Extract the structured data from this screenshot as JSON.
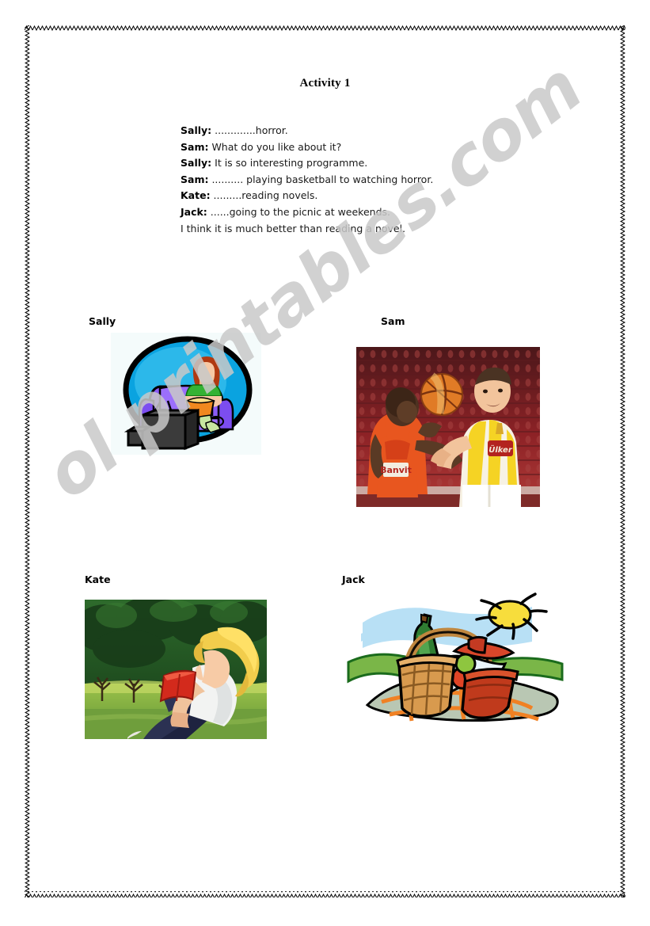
{
  "document": {
    "title": "Activity 1",
    "watermark": "ol printables.com"
  },
  "dialogue": {
    "lines": [
      {
        "speaker": "Sally:",
        "text": " .............horror."
      },
      {
        "speaker": "Sam:",
        "text": " What do you like about it?"
      },
      {
        "speaker": "Sally:",
        "text": " It is so interesting programme."
      },
      {
        "speaker": "Sam:",
        "text": " .......... playing basketball to watching horror."
      },
      {
        "speaker": "Kate:",
        "text": " .........reading novels."
      },
      {
        "speaker": "Jack:",
        "text": " ......going to the picnic at weekends."
      },
      {
        "speaker": "",
        "text": "I think it is much better than reading a novel."
      }
    ]
  },
  "pictures": [
    {
      "label": "Sally",
      "alt": "Cartoon of a girl sitting on a purple couch eating popcorn and watching a television, inside a blue circle",
      "subject": "watching-tv"
    },
    {
      "label": "Sam",
      "alt": "Photograph of two basketball players competing for the ball, one in an orange Banvit jersey and one in a yellow and white striped jersey",
      "subject": "playing-basketball",
      "jersey_text": "Banvit"
    },
    {
      "label": "Kate",
      "alt": "Painting of a blonde girl sitting on grass in a park reading a red book",
      "subject": "reading-novels"
    },
    {
      "label": "Jack",
      "alt": "Clipart of a picnic basket with a wine bottle, fruit and a blanket on grass under the sun",
      "subject": "going-to-the-picnic"
    }
  ]
}
